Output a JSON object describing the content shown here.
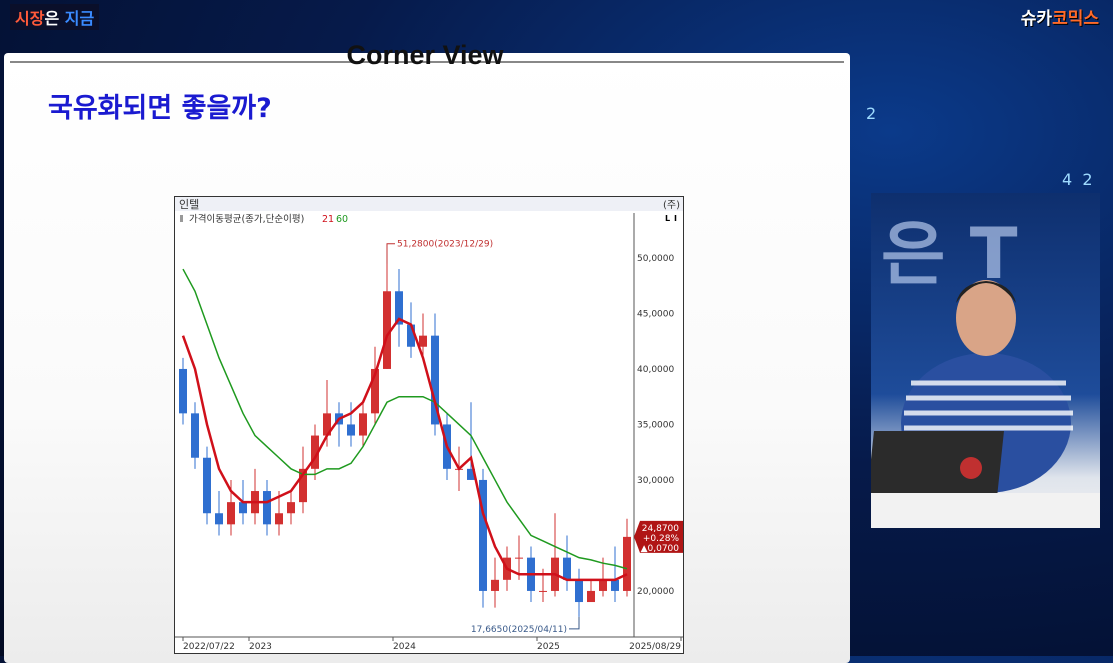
{
  "brand": {
    "show_logo": [
      "시장",
      "은 ",
      "지금"
    ],
    "channel_logo": [
      "슈카",
      "코믹스"
    ]
  },
  "slide": {
    "title": "Corner View",
    "subtitle": "국유화되면 좋을까?"
  },
  "chart_data": {
    "type": "candlestick",
    "stock_name": "인텔",
    "period": "(주)",
    "scale_buttons": [
      "L",
      "I"
    ],
    "indicator_label": "가격이동평균(종가,단순이평)",
    "ma_periods": [
      "21",
      "60"
    ],
    "ma_colors": {
      "21": "#d0101a",
      "60": "#1f9a1f"
    },
    "up_color": "#d23030",
    "down_color": "#2f6fd0",
    "x_labels": [
      "2022/07/22",
      "2023",
      "2024",
      "2025",
      "2025/08/29"
    ],
    "y_ticks": [
      "50,0000",
      "45,0000",
      "40,0000",
      "35,0000",
      "30,0000",
      "20,0000"
    ],
    "y_tick_values": [
      50,
      45,
      40,
      35,
      30,
      20
    ],
    "ylim": [
      15.85,
      54.05
    ],
    "max_annotation": "51,2800(2023/12/29)",
    "max_value": 51.28,
    "max_month": "2023-12",
    "min_annotation": "17,6650(2025/04/11)",
    "min_value": 17.665,
    "min_month": "2025-04",
    "last_price": "24,8700",
    "change_pct": "+0.28%",
    "change_abs": "▲0,0700",
    "months": [
      "2022-07",
      "2022-08",
      "2022-09",
      "2022-10",
      "2022-11",
      "2022-12",
      "2023-01",
      "2023-02",
      "2023-03",
      "2023-04",
      "2023-05",
      "2023-06",
      "2023-07",
      "2023-08",
      "2023-09",
      "2023-10",
      "2023-11",
      "2023-12",
      "2024-01",
      "2024-02",
      "2024-03",
      "2024-04",
      "2024-05",
      "2024-06",
      "2024-07",
      "2024-08",
      "2024-09",
      "2024-10",
      "2024-11",
      "2024-12",
      "2025-01",
      "2025-02",
      "2025-03",
      "2025-04",
      "2025-05",
      "2025-06",
      "2025-07",
      "2025-08"
    ],
    "open": [
      40,
      36,
      32,
      27,
      26,
      28,
      27,
      29,
      26,
      27,
      28,
      31,
      34,
      36,
      35,
      34,
      36,
      40,
      47,
      44,
      42,
      43,
      35,
      31,
      31,
      30,
      20,
      21,
      23,
      23,
      20,
      20,
      23,
      21,
      19,
      20,
      21,
      20
    ],
    "high": [
      41,
      37,
      33,
      29,
      30,
      30,
      31,
      30,
      29,
      29,
      33,
      35,
      39,
      37,
      37,
      37,
      42,
      51.28,
      49,
      46,
      45,
      45,
      36,
      33,
      37,
      31,
      23,
      24,
      25,
      24,
      22,
      27,
      25,
      22,
      21,
      23,
      24,
      26.5
    ],
    "low": [
      35,
      31,
      26,
      25,
      25,
      26,
      26,
      25,
      25,
      26,
      27,
      30,
      33,
      33,
      33,
      33,
      35,
      40,
      42,
      41,
      41,
      34,
      30,
      29,
      30,
      18.5,
      18.5,
      20,
      21,
      19,
      19,
      19.5,
      20,
      17.665,
      19,
      19.5,
      19,
      19.5
    ],
    "close": [
      36,
      32,
      27,
      26,
      28,
      27,
      29,
      26,
      27,
      28,
      31,
      34,
      36,
      35,
      34,
      36,
      40,
      47,
      44,
      42,
      43,
      35,
      31,
      31,
      30,
      20,
      21,
      23,
      23,
      20,
      20,
      23,
      21,
      19,
      20,
      21,
      20,
      24.87
    ],
    "ma21": [
      43,
      40,
      35,
      31,
      29,
      28,
      28,
      28,
      28.5,
      29,
      30.5,
      32,
      34,
      35.5,
      36,
      37,
      39.5,
      43,
      44.5,
      44,
      41,
      37,
      33,
      31,
      32,
      27,
      24,
      22,
      21.5,
      21.5,
      21.5,
      21.5,
      21,
      21,
      21,
      21,
      21,
      21.5
    ],
    "ma60": [
      49,
      47,
      44,
      41,
      38.5,
      36,
      34,
      33,
      32,
      31,
      30.5,
      30.5,
      31,
      31,
      31.5,
      33,
      35,
      37,
      37.5,
      37.5,
      37.5,
      37,
      36,
      35,
      34,
      32,
      30,
      28,
      26.5,
      25,
      24.5,
      24,
      23.5,
      23,
      22.8,
      22.5,
      22.3,
      22
    ]
  }
}
